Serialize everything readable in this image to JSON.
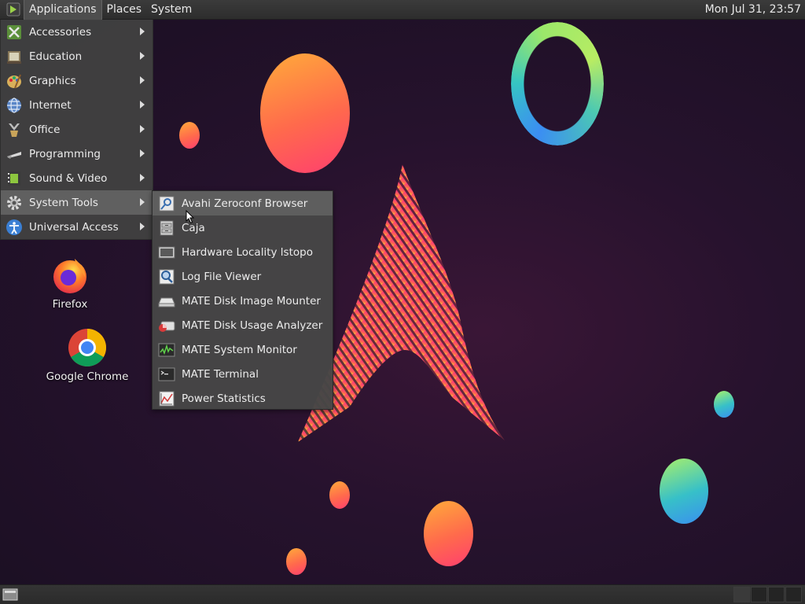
{
  "top_panel": {
    "menus": [
      "Applications",
      "Places",
      "System"
    ],
    "clock": "Mon Jul 31, 23:57"
  },
  "applications_menu": {
    "items": [
      {
        "label": "Accessories",
        "icon": "accessories-icon"
      },
      {
        "label": "Education",
        "icon": "education-icon"
      },
      {
        "label": "Graphics",
        "icon": "graphics-icon"
      },
      {
        "label": "Internet",
        "icon": "internet-globe-icon"
      },
      {
        "label": "Office",
        "icon": "office-icon"
      },
      {
        "label": "Programming",
        "icon": "programming-icon"
      },
      {
        "label": "Sound & Video",
        "icon": "sound-video-icon"
      },
      {
        "label": "System Tools",
        "icon": "gear-icon"
      },
      {
        "label": "Universal Access",
        "icon": "accessibility-icon"
      }
    ],
    "highlighted": "System Tools"
  },
  "system_tools_submenu": {
    "items": [
      {
        "label": "Avahi Zeroconf Browser",
        "icon": "network-search-icon"
      },
      {
        "label": "Caja",
        "icon": "file-cabinet-icon"
      },
      {
        "label": "Hardware Locality lstopo",
        "icon": "monitor-icon"
      },
      {
        "label": "Log File Viewer",
        "icon": "magnifier-icon"
      },
      {
        "label": "MATE Disk Image Mounter",
        "icon": "disk-drive-icon"
      },
      {
        "label": "MATE Disk Usage Analyzer",
        "icon": "disk-usage-icon"
      },
      {
        "label": "MATE System Monitor",
        "icon": "system-monitor-icon"
      },
      {
        "label": "MATE Terminal",
        "icon": "terminal-icon"
      },
      {
        "label": "Power Statistics",
        "icon": "power-graph-icon"
      }
    ],
    "hovered": "Avahi Zeroconf Browser"
  },
  "desktop_icons": [
    {
      "label": "Firefox",
      "icon": "firefox-icon"
    },
    {
      "label": "Google Chrome",
      "icon": "chrome-icon"
    }
  ],
  "colors": {
    "panel": "#2d2d2d",
    "menu_bg": "#404040",
    "menu_highlight": "#606060",
    "wallpaper": "#1d0f24",
    "accent_pink": "#ff3f6f",
    "accent_orange": "#ffab3a"
  }
}
